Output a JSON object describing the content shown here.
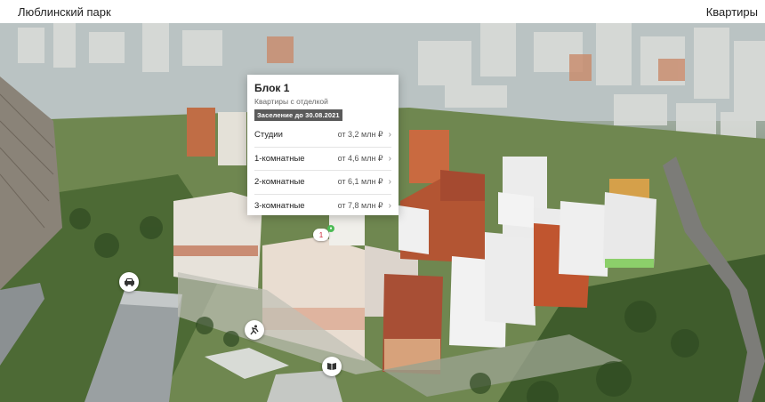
{
  "header": {
    "brand": "Люблинский парк",
    "nav_link": "Квартиры"
  },
  "popup": {
    "title": "Блок 1",
    "subtitle": "Квартиры с отделкой",
    "badge": "Заселение до 30.08.2021",
    "rows": [
      {
        "name": "Студии",
        "price": "от 3,2 млн ₽"
      },
      {
        "name": "1-комнатные",
        "price": "от 4,6 млн ₽"
      },
      {
        "name": "2-комнатные",
        "price": "от 6,1 млн ₽"
      },
      {
        "name": "3-комнатные",
        "price": "от 7,8 млн ₽"
      }
    ]
  },
  "marker": {
    "label": "1"
  },
  "icons": {
    "parking": "car-icon",
    "sport": "sport-icon",
    "school": "book-icon",
    "chevron": "chevron-right-icon"
  },
  "colors": {
    "popup_badge": "#5a5a5a",
    "marker_dot": "#4cbb55"
  }
}
